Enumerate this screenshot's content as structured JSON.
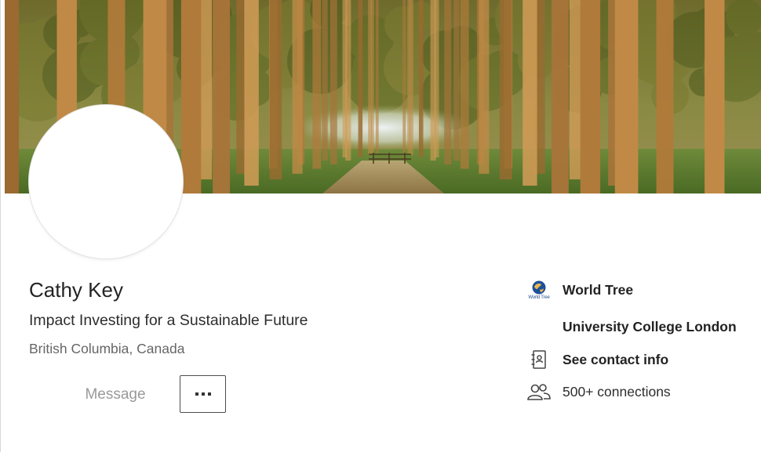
{
  "profile": {
    "name": "Cathy Key",
    "headline": "Impact Investing for a Sustainable Future",
    "location": "British Columbia, Canada"
  },
  "actions": {
    "message_label": "Message",
    "more_icon": "ellipsis-icon"
  },
  "sidebar": {
    "company": {
      "label": "World Tree",
      "logo_caption": "World Tree",
      "icon": "world-tree-logo"
    },
    "school": {
      "label": "University College London"
    },
    "contact": {
      "label": "See contact info",
      "icon": "address-book-icon"
    },
    "connections": {
      "label": "500+ connections",
      "icon": "people-icon"
    }
  },
  "colors": {
    "primary_text": "#232323",
    "secondary_text": "#666666",
    "muted_button": "#9a9a9a",
    "border": "#d8d8d8"
  }
}
